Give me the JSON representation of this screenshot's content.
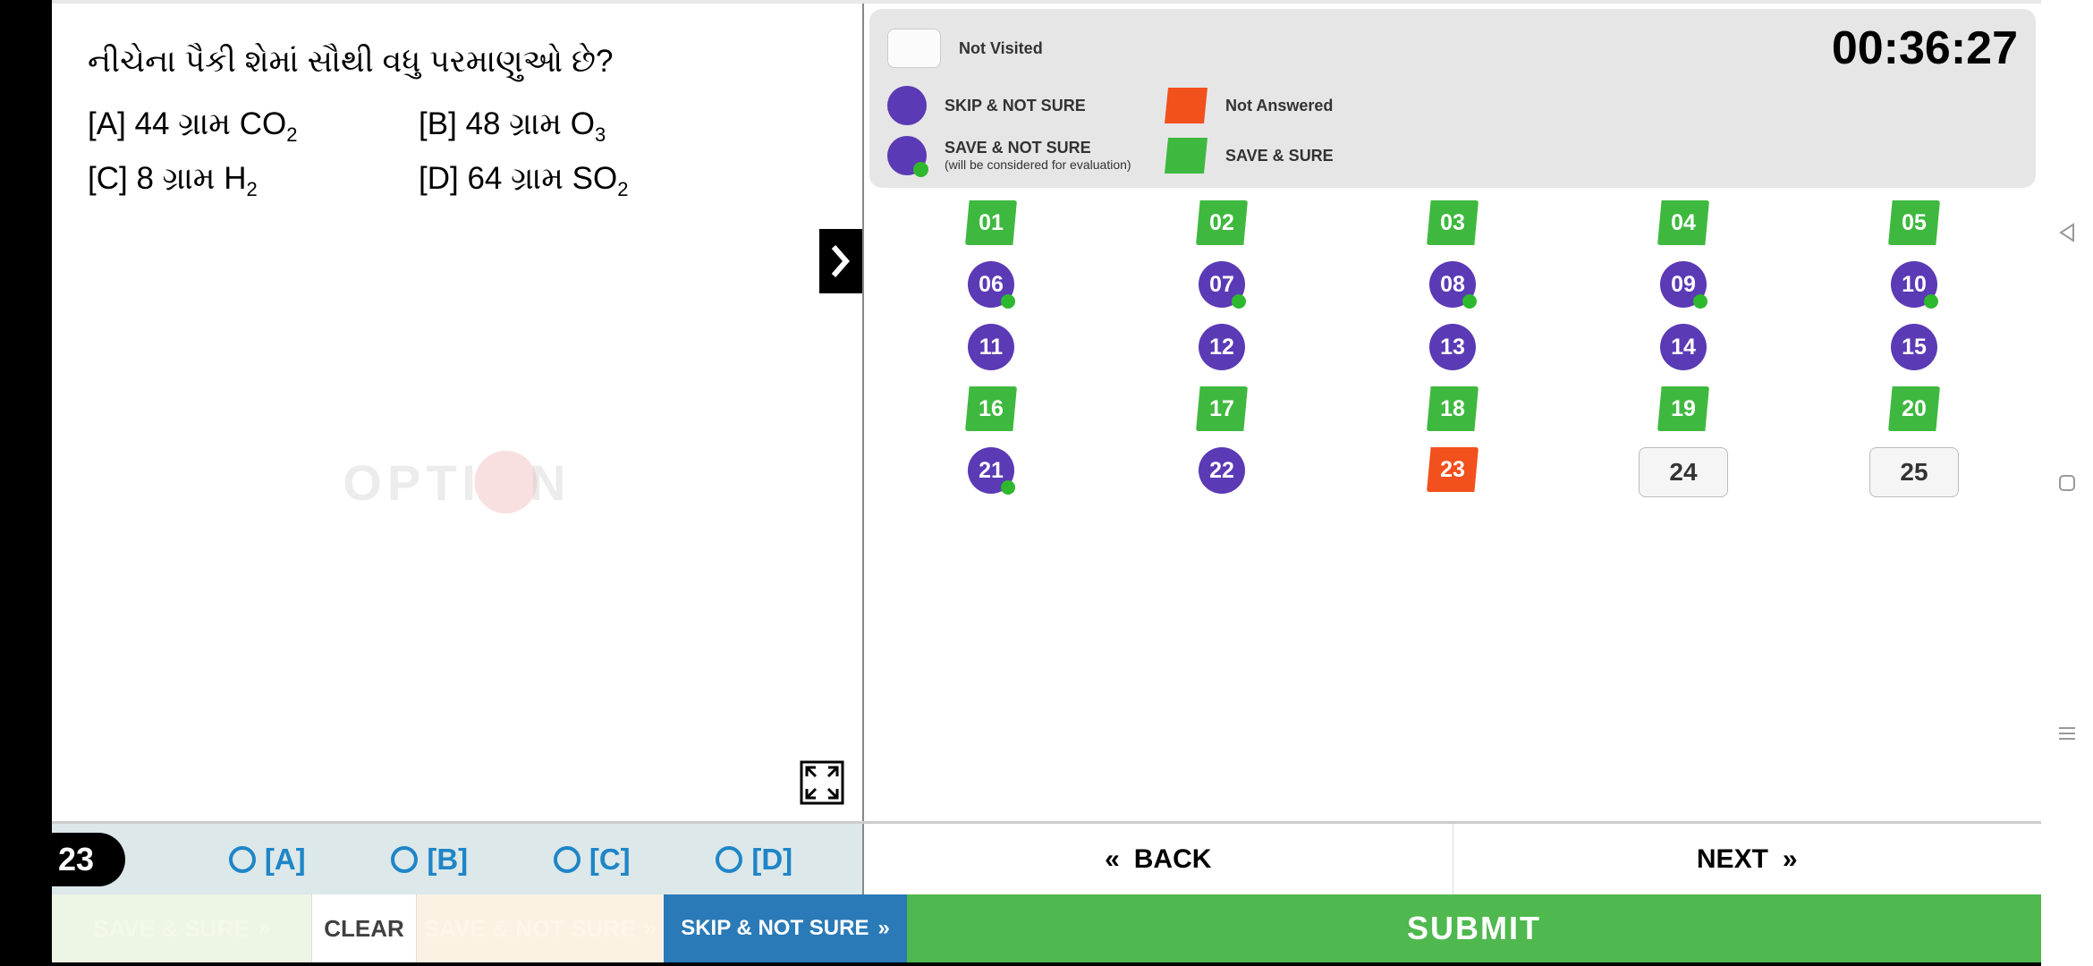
{
  "question": {
    "number": "23",
    "text": "નીચેના પૈકી શેમાં સૌથી વધુ પરમાણુઓ છે?",
    "options": {
      "A": {
        "label": "[A]",
        "pre": "44 ગ્રામ CO",
        "sub": "2"
      },
      "B": {
        "label": "[B]",
        "pre": "48 ગ્રામ O",
        "sub": "3"
      },
      "C": {
        "label": "[C]",
        "pre": "8 ગ્રામ H",
        "sub": "2"
      },
      "D": {
        "label": "[D]",
        "pre": "64 ગ્રામ  SO",
        "sub": "2"
      }
    }
  },
  "watermark": {
    "left": "OPTI",
    "right": "N"
  },
  "timer": "00:36:27",
  "legend": {
    "not_visited": "Not Visited",
    "skip_not_sure": "SKIP & NOT SURE",
    "not_answered": "Not Answered",
    "save_not_sure": "SAVE & NOT SURE",
    "save_not_sure_sub": "(will be considered for evaluation)",
    "save_sure": "SAVE & SURE"
  },
  "grid": [
    {
      "n": "01",
      "s": "green-flag"
    },
    {
      "n": "02",
      "s": "green-flag"
    },
    {
      "n": "03",
      "s": "green-flag"
    },
    {
      "n": "04",
      "s": "green-flag"
    },
    {
      "n": "05",
      "s": "green-flag"
    },
    {
      "n": "06",
      "s": "purple-dot"
    },
    {
      "n": "07",
      "s": "purple-dot"
    },
    {
      "n": "08",
      "s": "purple-dot"
    },
    {
      "n": "09",
      "s": "purple-dot"
    },
    {
      "n": "10",
      "s": "purple-dot"
    },
    {
      "n": "11",
      "s": "purple"
    },
    {
      "n": "12",
      "s": "purple"
    },
    {
      "n": "13",
      "s": "purple"
    },
    {
      "n": "14",
      "s": "purple"
    },
    {
      "n": "15",
      "s": "purple"
    },
    {
      "n": "16",
      "s": "green-flag"
    },
    {
      "n": "17",
      "s": "green-flag"
    },
    {
      "n": "18",
      "s": "green-flag"
    },
    {
      "n": "19",
      "s": "green-flag"
    },
    {
      "n": "20",
      "s": "green-flag"
    },
    {
      "n": "21",
      "s": "purple-dot"
    },
    {
      "n": "22",
      "s": "purple"
    },
    {
      "n": "23",
      "s": "orange-flag"
    },
    {
      "n": "24",
      "s": "not-visited"
    },
    {
      "n": "25",
      "s": "not-visited"
    }
  ],
  "answer_labels": {
    "A": "[A]",
    "B": "[B]",
    "C": "[C]",
    "D": "[D]"
  },
  "nav": {
    "back": "BACK",
    "next": "NEXT"
  },
  "buttons": {
    "save_sure": "SAVE & SURE",
    "clear": "CLEAR",
    "save_not_sure": "SAVE & NOT SURE",
    "skip_not_sure": "SKIP & NOT SURE",
    "submit": "SUBMIT"
  },
  "colors": {
    "green": "#3fb83f",
    "purple": "#5b3ab5",
    "orange": "#f2501d",
    "blue": "#2a7ab8"
  }
}
